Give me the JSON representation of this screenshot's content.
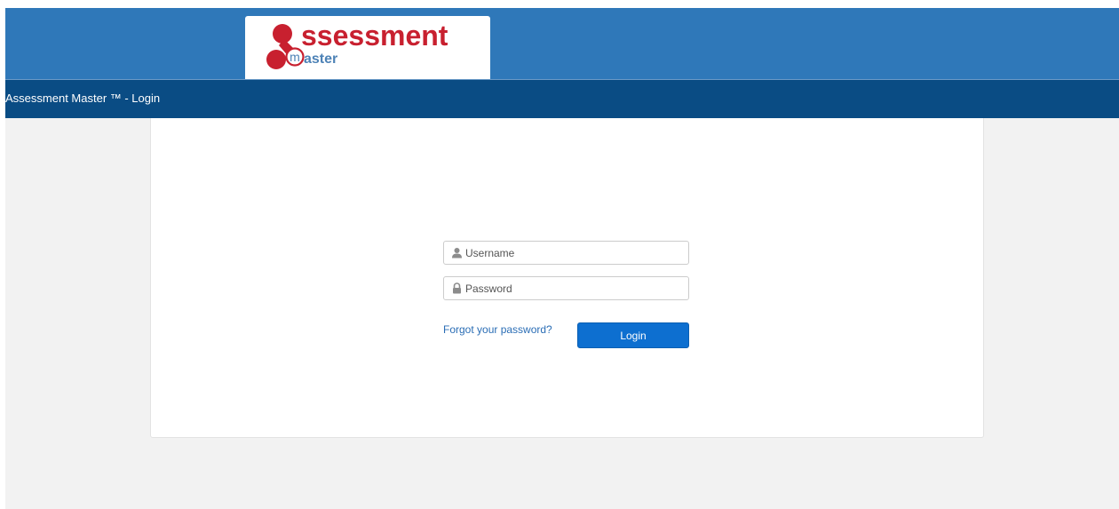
{
  "logo": {
    "word": "ssessment",
    "sub_word": "aster",
    "initial": "m",
    "brand_red": "#c8202f",
    "brand_blue": "#4d82b6"
  },
  "title_bar": {
    "text": "Assessment Master ™ - Login"
  },
  "login": {
    "username_placeholder": "Username",
    "password_placeholder": "Password",
    "forgot_link": "Forgot your password?",
    "login_button": "Login",
    "username_icon": "user-icon",
    "password_icon": "lock-icon"
  },
  "colors": {
    "banner": "#2f78b9",
    "title_bar": "#0a4c84",
    "button": "#0d6fd0",
    "link": "#2a6db5",
    "background": "#f2f2f2"
  }
}
